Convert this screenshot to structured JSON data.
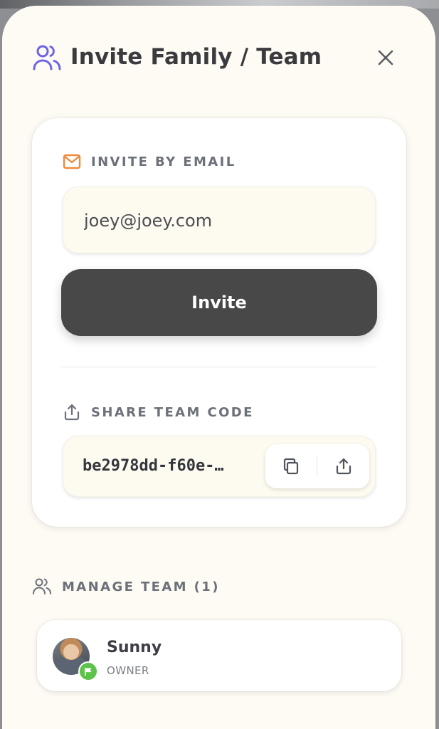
{
  "modal": {
    "title": "Invite Family / Team",
    "title_icon": "users-icon",
    "close_icon": "close-icon"
  },
  "invite_section": {
    "label": "INVITE BY EMAIL",
    "icon": "mail-icon",
    "email_value": "joey@joey.com",
    "button_label": "Invite"
  },
  "share_section": {
    "label": "SHARE TEAM CODE",
    "icon": "share-icon",
    "code_display": "be2978dd-f60e-…",
    "copy_icon": "copy-icon",
    "share_button_icon": "share-icon"
  },
  "manage_section": {
    "label": "MANAGE TEAM (1)",
    "icon": "users-icon",
    "members": [
      {
        "name": "Sunny",
        "role": "OWNER",
        "badge_icon": "flag-icon"
      }
    ]
  },
  "colors": {
    "accent_purple": "#6b63e8",
    "mail_orange": "#f08a3c",
    "button_dark": "#484848",
    "badge_green": "#5cc24a",
    "modal_bg": "#fdfbf3"
  }
}
